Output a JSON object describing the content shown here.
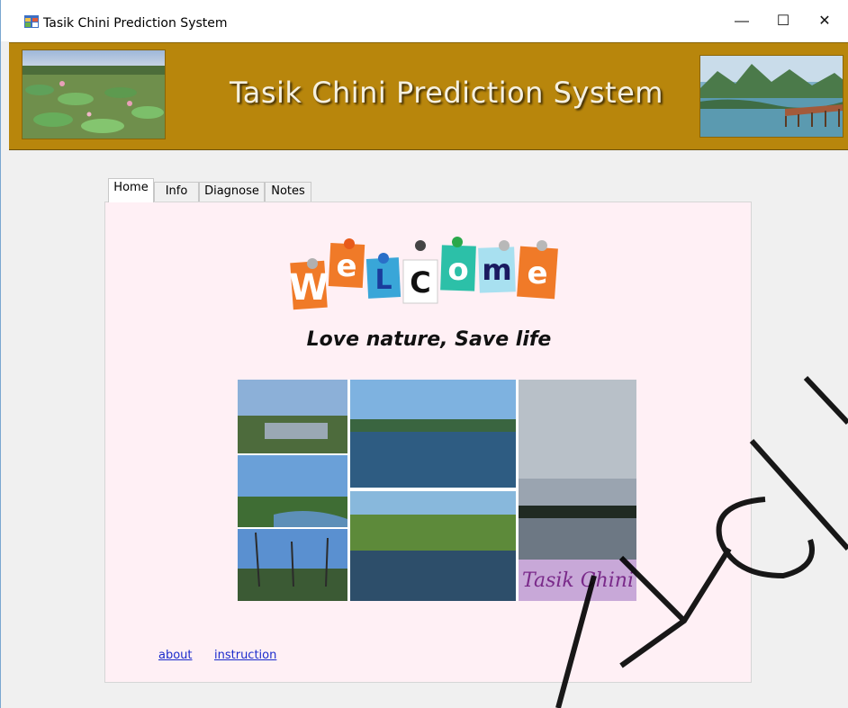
{
  "window": {
    "title": "Tasik Chini Prediction System",
    "controls": {
      "minimize": "—",
      "maximize": "☐",
      "close": "✕"
    }
  },
  "banner": {
    "title": "Tasik Chini Prediction System",
    "left_image": "lotus-lake-photo",
    "right_image": "lake-jetty-photo",
    "background_color": "#b8860c"
  },
  "tabs": [
    {
      "label": "Home",
      "active": true
    },
    {
      "label": "Info",
      "active": false
    },
    {
      "label": "Diagnose",
      "active": false
    },
    {
      "label": "Notes",
      "active": false
    }
  ],
  "home": {
    "welcome_letters": [
      "W",
      "e",
      "L",
      "C",
      "o",
      "m",
      "e"
    ],
    "slogan": "Love nature, Save life",
    "collage_caption": "Tasik Chini",
    "links": {
      "about": "about",
      "instruction": "instruction"
    },
    "panel_color": "#fff0f5"
  },
  "watermark": "UTM OFTSM"
}
